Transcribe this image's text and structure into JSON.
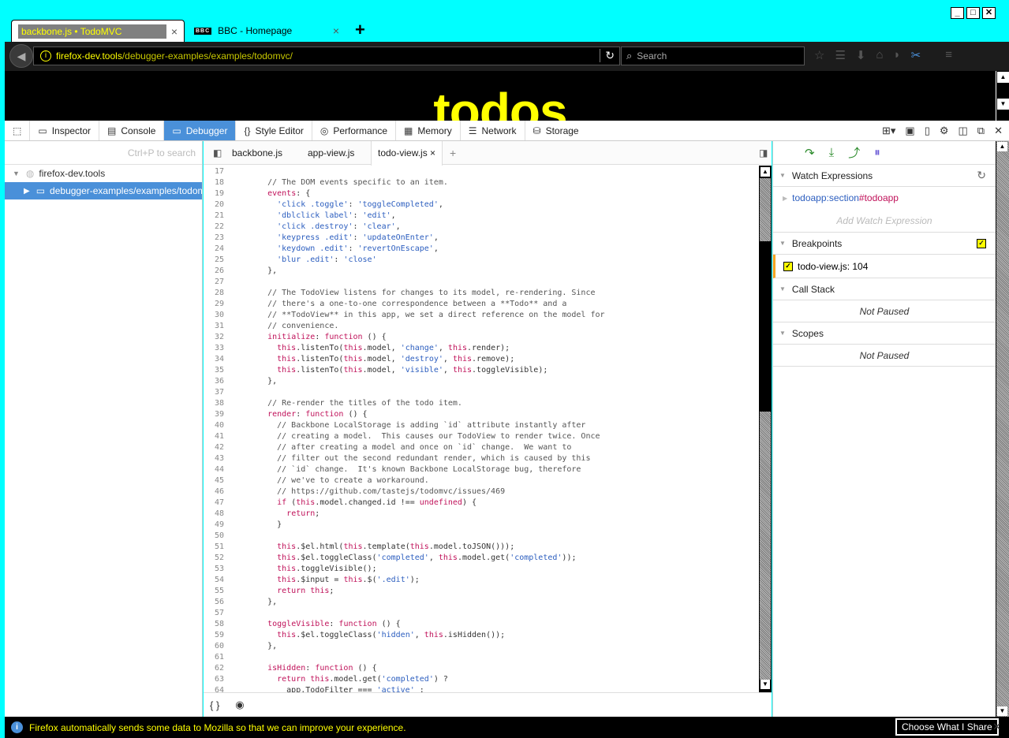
{
  "window": {
    "controls": [
      "_",
      "□",
      "✕"
    ]
  },
  "tabs": [
    {
      "title": "backbone.js • TodoMVC",
      "close": "×"
    },
    {
      "title": "BBC - Homepage",
      "icon": "BBC",
      "close": "×"
    }
  ],
  "new_tab": "+",
  "navbar": {
    "url_host": "firefox-dev.tools",
    "url_path": "/debugger-examples/examples/todomvc/",
    "search_placeholder": "Search"
  },
  "page": {
    "heading": "todos"
  },
  "devtools": {
    "tabs": [
      {
        "label": "",
        "icon": "pick-icon"
      },
      {
        "label": "Inspector",
        "icon": "inspector-icon"
      },
      {
        "label": "Console",
        "icon": "console-icon"
      },
      {
        "label": "Debugger",
        "icon": "debugger-icon",
        "selected": true
      },
      {
        "label": "Style Editor",
        "icon": "style-editor-icon"
      },
      {
        "label": "Performance",
        "icon": "performance-icon"
      },
      {
        "label": "Memory",
        "icon": "memory-icon"
      },
      {
        "label": "Network",
        "icon": "network-icon"
      },
      {
        "label": "Storage",
        "icon": "storage-icon"
      }
    ],
    "sources": {
      "search_hint": "Ctrl+P to search",
      "host": "firefox-dev.tools",
      "folder": "debugger-examples/examples/todomvc"
    },
    "editor_tabs": [
      {
        "label": "backbone.js"
      },
      {
        "label": "app-view.js"
      },
      {
        "label": "todo-view.js",
        "selected": true,
        "close": "×"
      }
    ],
    "code_lines": [
      {
        "n": "17",
        "t": ""
      },
      {
        "n": "18",
        "t": "    // The DOM events specific to an item."
      },
      {
        "n": "19",
        "t": "    events: {"
      },
      {
        "n": "20",
        "t": "      'click .toggle': 'toggleCompleted',"
      },
      {
        "n": "21",
        "t": "      'dblclick label': 'edit',"
      },
      {
        "n": "22",
        "t": "      'click .destroy': 'clear',"
      },
      {
        "n": "23",
        "t": "      'keypress .edit': 'updateOnEnter',"
      },
      {
        "n": "24",
        "t": "      'keydown .edit': 'revertOnEscape',"
      },
      {
        "n": "25",
        "t": "      'blur .edit': 'close'"
      },
      {
        "n": "26",
        "t": "    },"
      },
      {
        "n": "27",
        "t": ""
      },
      {
        "n": "28",
        "t": "    // The TodoView listens for changes to its model, re-rendering. Since"
      },
      {
        "n": "29",
        "t": "    // there's a one-to-one correspondence between a **Todo** and a"
      },
      {
        "n": "30",
        "t": "    // **TodoView** in this app, we set a direct reference on the model for"
      },
      {
        "n": "31",
        "t": "    // convenience."
      },
      {
        "n": "32",
        "t": "    initialize: function () {"
      },
      {
        "n": "33",
        "t": "      this.listenTo(this.model, 'change', this.render);"
      },
      {
        "n": "34",
        "t": "      this.listenTo(this.model, 'destroy', this.remove);"
      },
      {
        "n": "35",
        "t": "      this.listenTo(this.model, 'visible', this.toggleVisible);"
      },
      {
        "n": "36",
        "t": "    },"
      },
      {
        "n": "37",
        "t": ""
      },
      {
        "n": "38",
        "t": "    // Re-render the titles of the todo item."
      },
      {
        "n": "39",
        "t": "    render: function () {"
      },
      {
        "n": "40",
        "t": "      // Backbone LocalStorage is adding `id` attribute instantly after"
      },
      {
        "n": "41",
        "t": "      // creating a model.  This causes our TodoView to render twice. Once"
      },
      {
        "n": "42",
        "t": "      // after creating a model and once on `id` change.  We want to"
      },
      {
        "n": "43",
        "t": "      // filter out the second redundant render, which is caused by this"
      },
      {
        "n": "44",
        "t": "      // `id` change.  It's known Backbone LocalStorage bug, therefore"
      },
      {
        "n": "45",
        "t": "      // we've to create a workaround."
      },
      {
        "n": "46",
        "t": "      // https://github.com/tastejs/todomvc/issues/469"
      },
      {
        "n": "47",
        "t": "      if (this.model.changed.id !== undefined) {"
      },
      {
        "n": "48",
        "t": "        return;"
      },
      {
        "n": "49",
        "t": "      }"
      },
      {
        "n": "50",
        "t": ""
      },
      {
        "n": "51",
        "t": "      this.$el.html(this.template(this.model.toJSON()));"
      },
      {
        "n": "52",
        "t": "      this.$el.toggleClass('completed', this.model.get('completed'));"
      },
      {
        "n": "53",
        "t": "      this.toggleVisible();"
      },
      {
        "n": "54",
        "t": "      this.$input = this.$('.edit');"
      },
      {
        "n": "55",
        "t": "      return this;"
      },
      {
        "n": "56",
        "t": "    },"
      },
      {
        "n": "57",
        "t": ""
      },
      {
        "n": "58",
        "t": "    toggleVisible: function () {"
      },
      {
        "n": "59",
        "t": "      this.$el.toggleClass('hidden', this.isHidden());"
      },
      {
        "n": "60",
        "t": "    },"
      },
      {
        "n": "61",
        "t": ""
      },
      {
        "n": "62",
        "t": "    isHidden: function () {"
      },
      {
        "n": "63",
        "t": "      return this.model.get('completed') ?"
      },
      {
        "n": "64",
        "t": "        app.TodoFilter === 'active' :"
      }
    ],
    "footer": {
      "pretty": "{ }",
      "eye": "◉"
    },
    "right": {
      "watch_title": "Watch Expressions",
      "watch_item_obj": "todoapp",
      "watch_item_sep": ": ",
      "watch_item_tag": "section",
      "watch_item_id": "#todoapp",
      "add_watch": "Add Watch Expression",
      "breakpoints_title": "Breakpoints",
      "breakpoint_item": "todo-view.js: 104",
      "callstack_title": "Call Stack",
      "callstack_status": "Not Paused",
      "scopes_title": "Scopes",
      "scopes_status": "Not Paused"
    }
  },
  "notification": {
    "text": "Firefox automatically sends some data to Mozilla so that we can improve your experience.",
    "button": "Choose What I Share",
    "close": "✕"
  }
}
